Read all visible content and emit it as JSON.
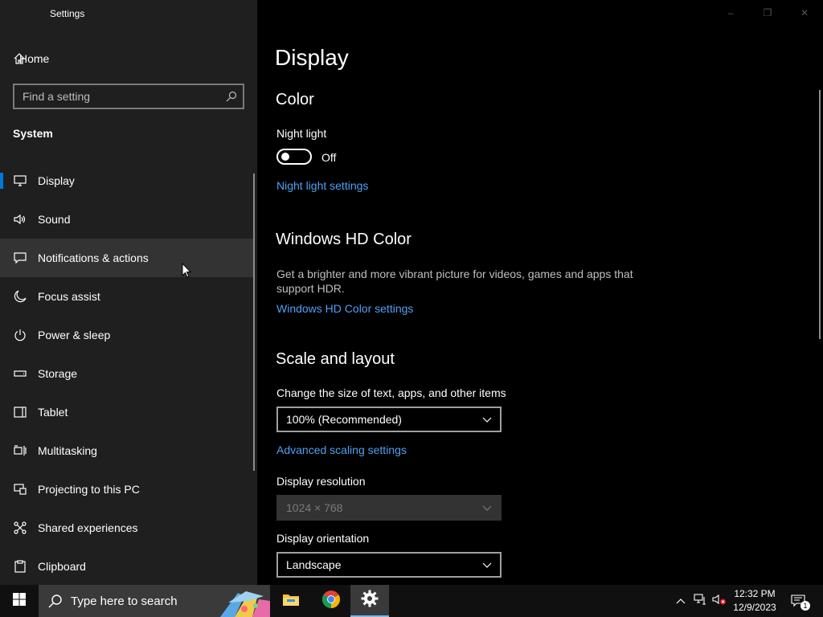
{
  "window": {
    "title": "Settings",
    "controls": [
      "–",
      "❐",
      "✕"
    ]
  },
  "sidebar": {
    "home_label": "Home",
    "search_placeholder": "Find a setting",
    "section_title": "System",
    "items": [
      {
        "label": "Display",
        "icon": "monitor-icon"
      },
      {
        "label": "Sound",
        "icon": "speaker-icon"
      },
      {
        "label": "Notifications & actions",
        "icon": "message-icon"
      },
      {
        "label": "Focus assist",
        "icon": "moon-icon"
      },
      {
        "label": "Power & sleep",
        "icon": "power-icon"
      },
      {
        "label": "Storage",
        "icon": "storage-icon"
      },
      {
        "label": "Tablet",
        "icon": "tablet-icon"
      },
      {
        "label": "Multitasking",
        "icon": "multitasking-icon"
      },
      {
        "label": "Projecting to this PC",
        "icon": "projecting-icon"
      },
      {
        "label": "Shared experiences",
        "icon": "shared-icon"
      },
      {
        "label": "Clipboard",
        "icon": "clipboard-icon"
      }
    ]
  },
  "main": {
    "page_title": "Display",
    "color": {
      "heading": "Color",
      "night_light_label": "Night light",
      "night_light_state": "Off",
      "night_light_link": "Night light settings"
    },
    "hdr": {
      "heading": "Windows HD Color",
      "description": "Get a brighter and more vibrant picture for videos, games and apps that support HDR.",
      "link": "Windows HD Color settings"
    },
    "scale": {
      "heading": "Scale and layout",
      "size_label": "Change the size of text, apps, and other items",
      "size_value": "100% (Recommended)",
      "advanced_link": "Advanced scaling settings",
      "resolution_label": "Display resolution",
      "resolution_value": "1024 × 768",
      "orientation_label": "Display orientation",
      "orientation_value": "Landscape"
    }
  },
  "taskbar": {
    "search_text": "Type here to search",
    "apps": [
      "file-explorer-icon",
      "chrome-icon",
      "settings-icon"
    ],
    "time": "12:32 PM",
    "date": "12/9/2023",
    "notification_count": "1"
  },
  "colors": {
    "accent": "#0078d7",
    "link": "#4ea1f3",
    "sidebar_bg": "#1f1f1f",
    "main_bg": "#000000"
  }
}
